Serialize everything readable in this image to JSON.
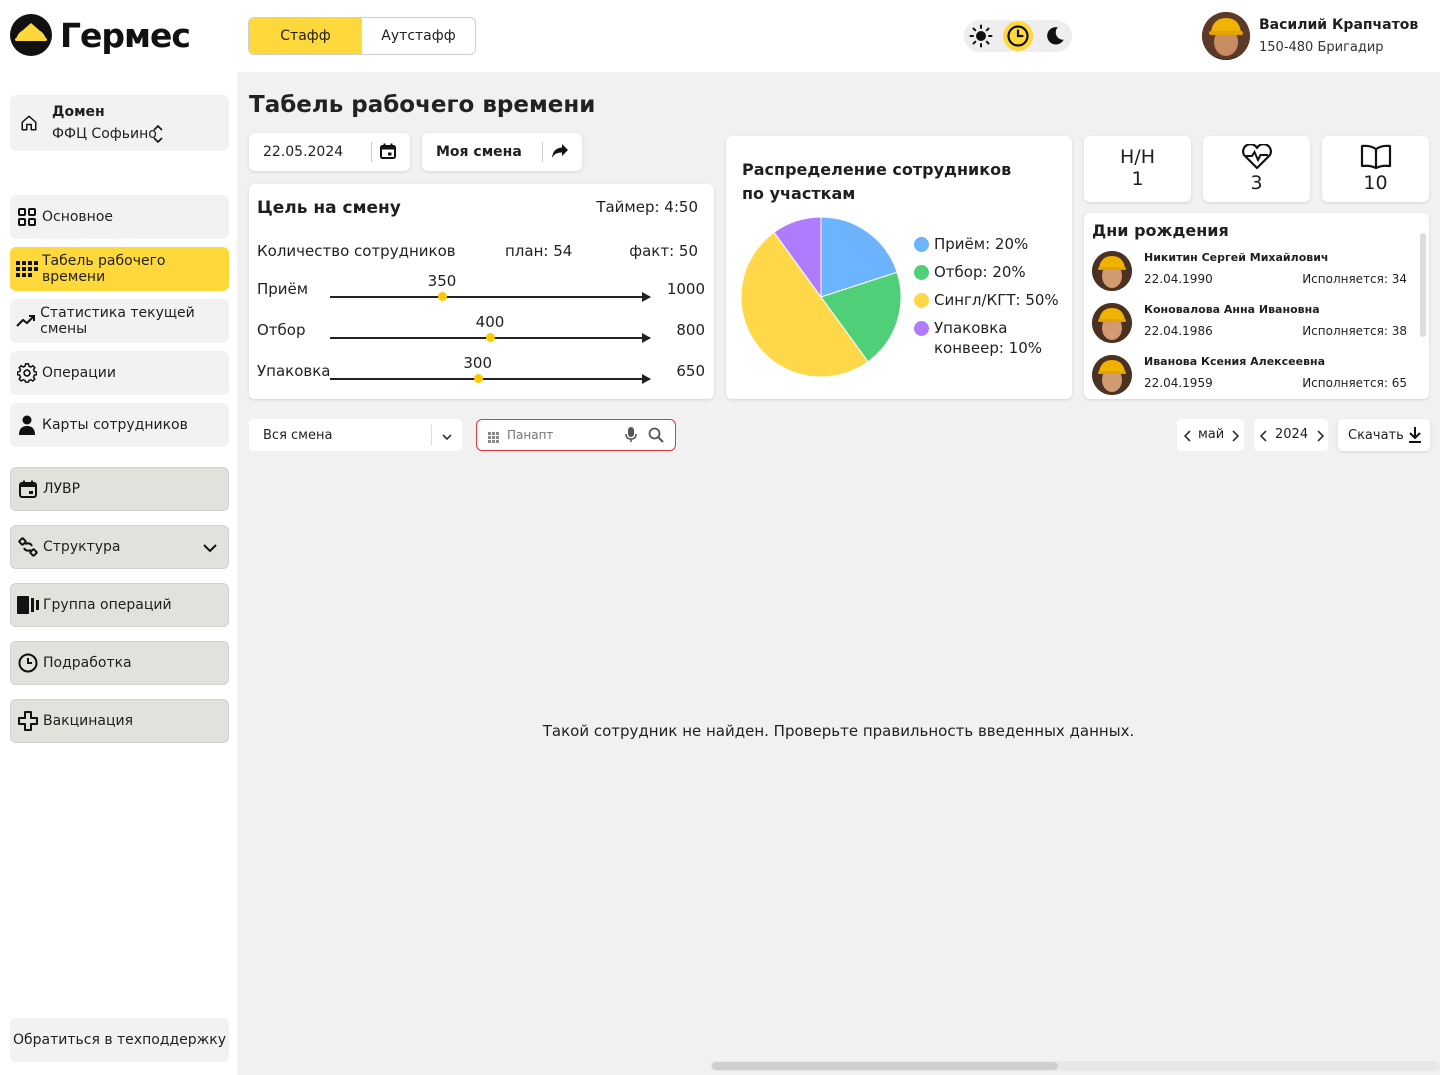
{
  "header": {
    "logo_text": "Гермес",
    "tabs": [
      {
        "label": "Стафф",
        "active": true
      },
      {
        "label": "Аутстафф",
        "active": false
      }
    ],
    "theme_icons": [
      "sun-icon",
      "clock-icon",
      "moon-icon"
    ],
    "user": {
      "name": "Василий Крапчатов",
      "role": "150-480 Бригадир"
    }
  },
  "sidebar": {
    "domain_label": "Домен",
    "domain_value": "ФФЦ Софьино",
    "items": [
      {
        "label": "Основное",
        "icon": "grid-icon"
      },
      {
        "label": "Табель рабочего времени",
        "icon": "dots-grid-icon",
        "active": true
      },
      {
        "label": "Статистика текущей смены",
        "icon": "trend-icon"
      },
      {
        "label": "Операции",
        "icon": "gear-icon"
      },
      {
        "label": "Карты сотрудников",
        "icon": "person-icon"
      },
      {
        "label": "ЛУВР",
        "icon": "calendar-icon"
      },
      {
        "label": "Структура",
        "icon": "structure-icon"
      },
      {
        "label": "Группа операций",
        "icon": "group-icon"
      },
      {
        "label": "Подработка",
        "icon": "clock-icon"
      },
      {
        "label": "Вакцинация",
        "icon": "cross-icon"
      }
    ],
    "support_label": "Обратиться в техподдержку"
  },
  "page": {
    "title": "Табель рабочего времени",
    "date": "22.05.2024",
    "shift": "Моя смена"
  },
  "goal": {
    "title": "Цель на смену",
    "timer": "Таймер: 4:50",
    "staff_label": "Количество сотрудников",
    "plan": "план: 54",
    "fact": "факт: 50",
    "rows": [
      {
        "label": "Приём",
        "current": 350,
        "target": 1000
      },
      {
        "label": "Отбор",
        "current": 400,
        "target": 800
      },
      {
        "label": "Упаковка",
        "current": 300,
        "target": 650
      }
    ]
  },
  "distribution": {
    "title_line1": "Распределение сотрудников",
    "title_line2": "по участкам"
  },
  "chart_data": {
    "type": "pie",
    "title": "Распределение сотрудников по участкам",
    "slices": [
      {
        "label": "Приём: 20%",
        "value": 20,
        "color": "#6cb4ff"
      },
      {
        "label": "Отбор: 20%",
        "value": 20,
        "color": "#4fcf78"
      },
      {
        "label": "Сингл/КГТ: 50%",
        "value": 50,
        "color": "#ffd84a"
      },
      {
        "label": "Упаковка конвеер: 10%",
        "value": 10,
        "color": "#b07cff"
      }
    ],
    "legend_position": "right"
  },
  "stats": [
    {
      "label": "Н/Н",
      "value": "1"
    },
    {
      "icon": "heart-pulse-icon",
      "value": "3"
    },
    {
      "icon": "book-icon",
      "value": "10"
    }
  ],
  "birthdays": {
    "title": "Дни рождения",
    "people": [
      {
        "name": "Никитин Сергей Михайлович",
        "date": "22.04.1990",
        "age": "Исполняется: 34"
      },
      {
        "name": "Коновалова Анна Ивановна",
        "date": "22.04.1986",
        "age": "Исполняется: 38"
      },
      {
        "name": "Иванова Ксения Алексеевна",
        "date": "22.04.1959",
        "age": "Исполняется: 65"
      }
    ]
  },
  "filters": {
    "shift_select": "Вся смена",
    "search_placeholder": "Панапт",
    "month": "май",
    "year": "2024",
    "download": "Скачать"
  },
  "empty_message": "Такой сотрудник не найден. Проверьте правильность введенных данных."
}
